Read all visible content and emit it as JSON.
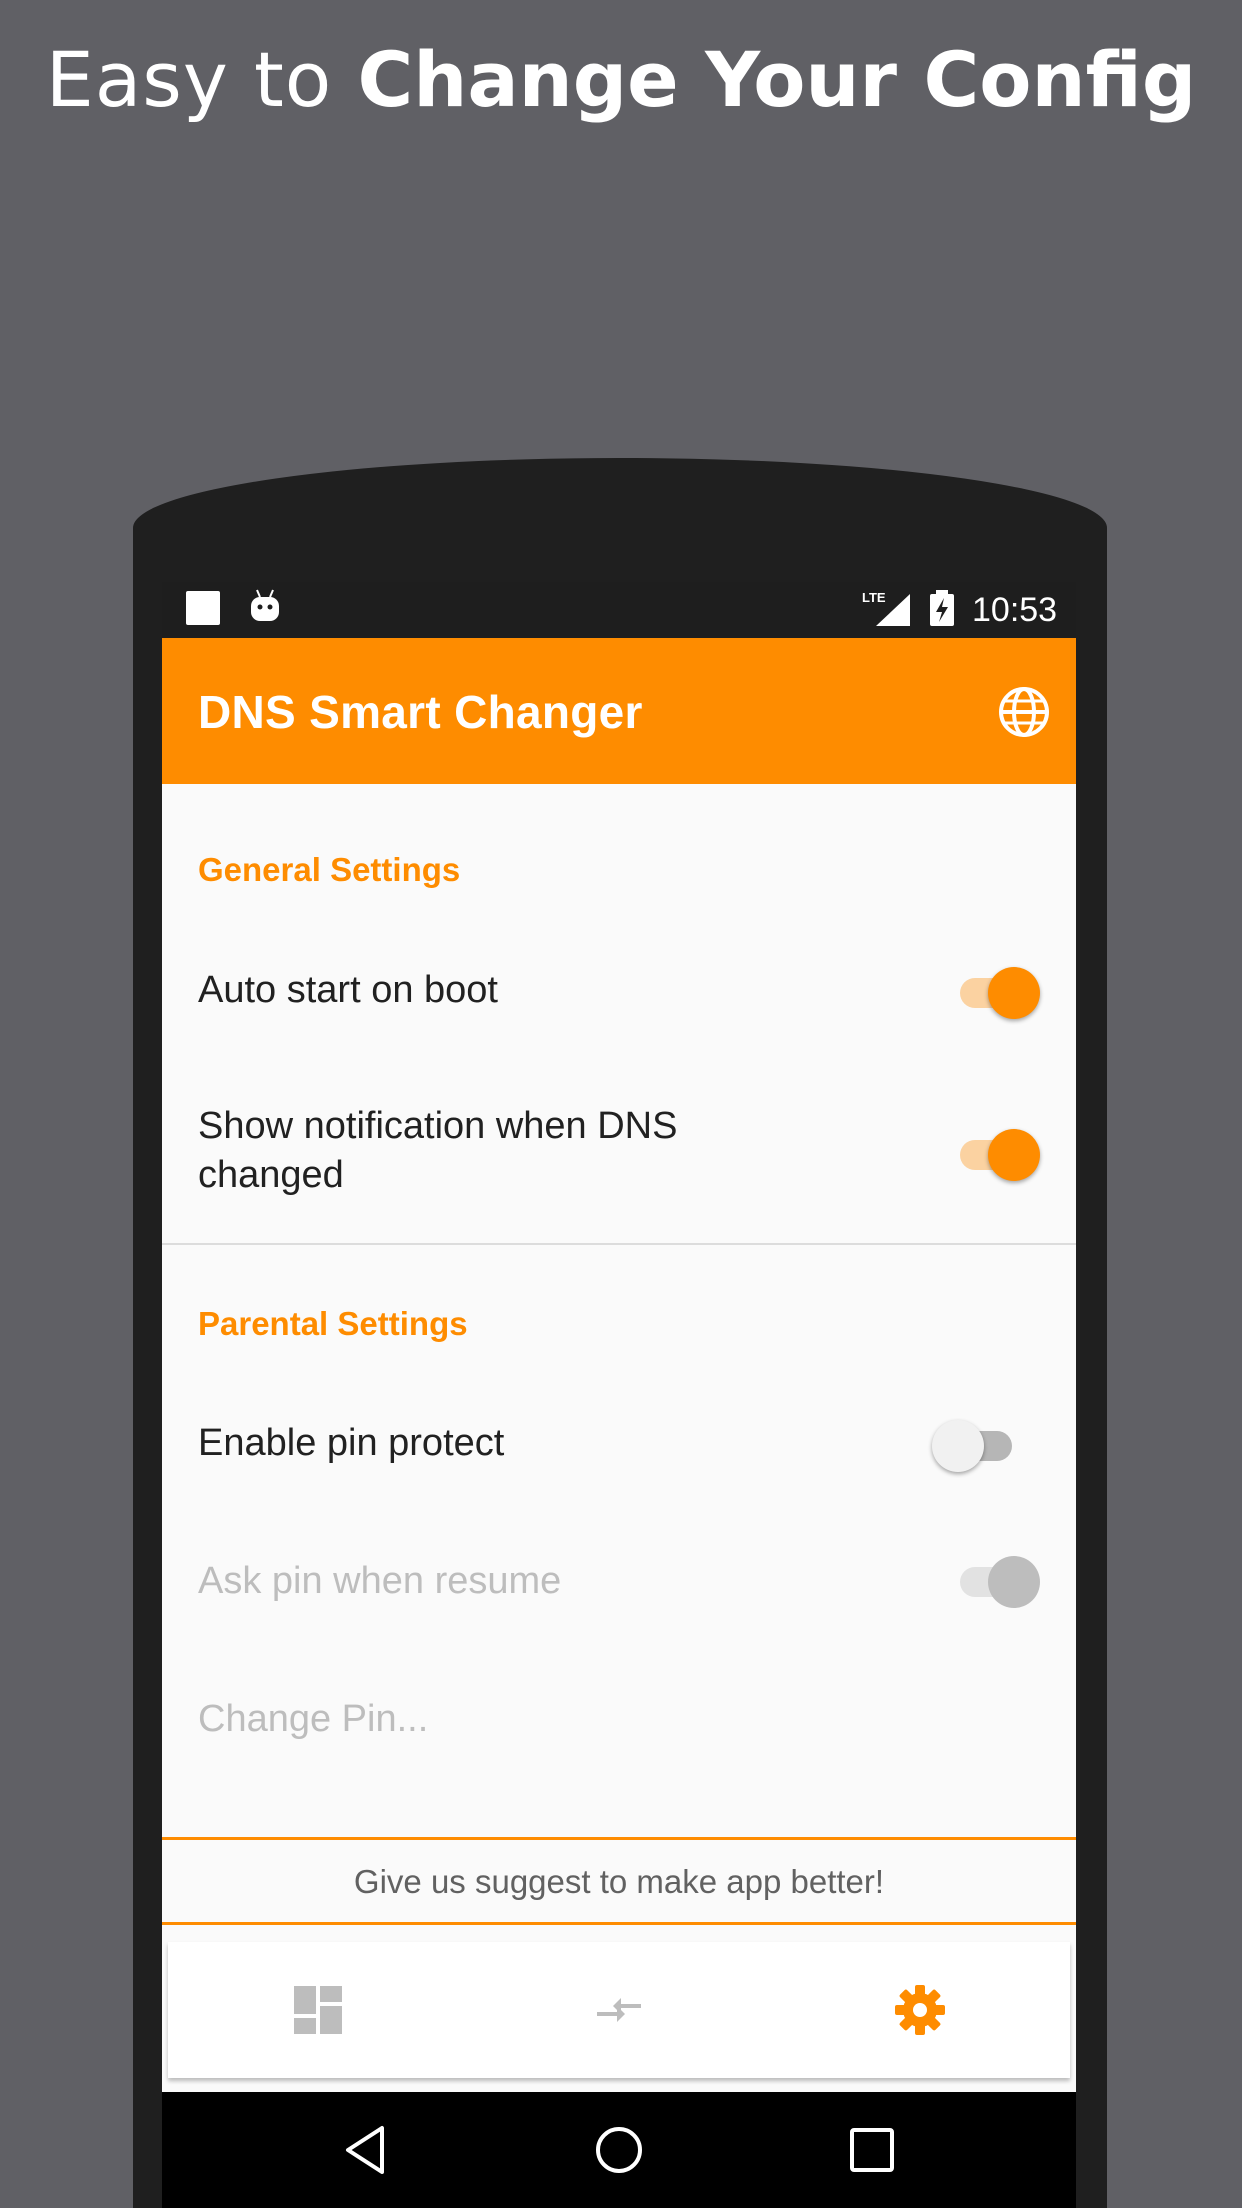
{
  "headline": {
    "light": "Easy to ",
    "bold": "Change Your Config"
  },
  "status_bar": {
    "time": "10:53",
    "network": "LTE"
  },
  "app_bar": {
    "title": "DNS Smart Changer",
    "action_icon": "globe-icon"
  },
  "sections": [
    {
      "header": "General Settings",
      "items": [
        {
          "label": "Auto start on boot",
          "switch": "on",
          "enabled": true
        },
        {
          "label": "Show notification when DNS changed",
          "label_line1": "Show notification when DNS",
          "label_line2": "changed",
          "switch": "on",
          "enabled": true
        }
      ]
    },
    {
      "header": "Parental Settings",
      "items": [
        {
          "label": "Enable pin protect",
          "switch": "off",
          "enabled": true
        },
        {
          "label": "Ask pin when resume",
          "switch": "on",
          "enabled": false
        },
        {
          "label": "Change Pin...",
          "enabled": false
        }
      ]
    }
  ],
  "feedback": {
    "text": "Give us suggest to make app better!"
  },
  "bottom_nav": [
    {
      "icon": "dashboard-icon",
      "active": false
    },
    {
      "icon": "compare-arrows-icon",
      "active": false
    },
    {
      "icon": "settings-gear-icon",
      "active": true
    }
  ],
  "colors": {
    "accent": "#fe8c00",
    "background": "#606065",
    "screen": "#fafafa"
  }
}
